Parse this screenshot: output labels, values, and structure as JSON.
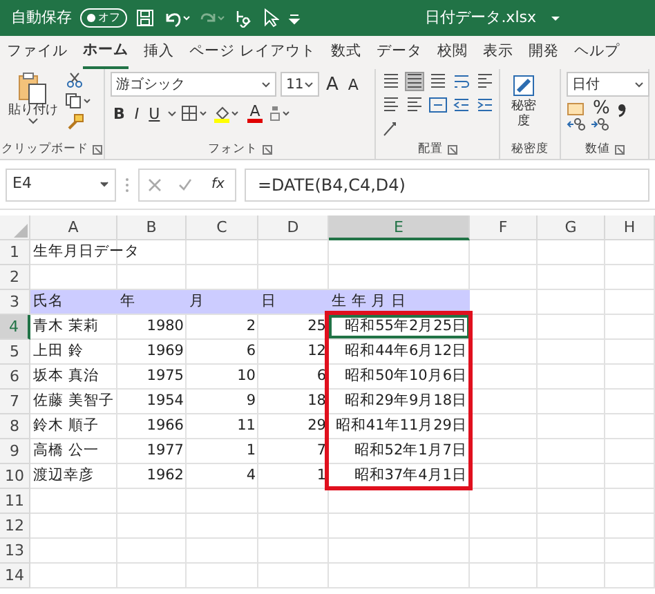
{
  "title_bar": {
    "autosave_label": "自動保存",
    "autosave_toggle": {
      "label": "オフ",
      "on": false
    },
    "file_name": "日付データ.xlsx"
  },
  "ribbon_tabs": [
    {
      "label": "ファイル",
      "selected": false
    },
    {
      "label": "ホーム",
      "selected": true
    },
    {
      "label": "挿入",
      "selected": false
    },
    {
      "label": "ページ レイアウト",
      "selected": false
    },
    {
      "label": "数式",
      "selected": false
    },
    {
      "label": "データ",
      "selected": false
    },
    {
      "label": "校閲",
      "selected": false
    },
    {
      "label": "表示",
      "selected": false
    },
    {
      "label": "開発",
      "selected": false
    },
    {
      "label": "ヘルプ",
      "selected": false
    }
  ],
  "ribbon": {
    "clipboard": {
      "paste_label": "貼り付け",
      "group_label": "クリップボード"
    },
    "font": {
      "font_name": "游ゴシック",
      "font_size": "11",
      "grow_letter": "A",
      "shrink_letter": "A",
      "bold": "B",
      "italic": "I",
      "underline": "U",
      "color_letter": "A",
      "group_label": "フォント"
    },
    "alignment": {
      "group_label": "配置"
    },
    "sensitivity": {
      "label": "秘密度",
      "group_label": "秘密度"
    },
    "number": {
      "format": "日付",
      "percent": "%",
      "group_label": "数値"
    }
  },
  "formula_bar": {
    "name_box": "E4",
    "fx_label": "fx",
    "formula": "=DATE(B4,C4,D4)"
  },
  "sheet": {
    "columns": [
      {
        "label": "A",
        "kind": "text",
        "selected": false
      },
      {
        "label": "B",
        "kind": "number",
        "selected": false
      },
      {
        "label": "C",
        "kind": "number",
        "selected": false
      },
      {
        "label": "D",
        "kind": "number",
        "selected": false
      },
      {
        "label": "E",
        "kind": "number",
        "selected": true,
        "boxed": true
      },
      {
        "label": "F",
        "kind": "number",
        "selected": false
      },
      {
        "label": "G",
        "kind": "number",
        "selected": false
      },
      {
        "label": "H",
        "kind": "number",
        "selected": false
      }
    ],
    "rows": [
      {
        "label": "1",
        "kind": "title",
        "selected": false,
        "cells": [
          "生年月日データ"
        ]
      },
      {
        "label": "2",
        "kind": "blank",
        "selected": false
      },
      {
        "label": "3",
        "kind": "header",
        "selected": false,
        "cells": [
          "氏名",
          "年",
          "月",
          "日",
          "生 年 月 日"
        ]
      },
      {
        "label": "4",
        "kind": "data",
        "selected": true,
        "cells": [
          "青木 茉莉",
          "1980",
          "2",
          "25",
          "昭和55年2月25日"
        ]
      },
      {
        "label": "5",
        "kind": "data",
        "selected": false,
        "cells": [
          "上田 鈴",
          "1969",
          "6",
          "12",
          "昭和44年6月12日"
        ]
      },
      {
        "label": "6",
        "kind": "data",
        "selected": false,
        "cells": [
          "坂本 真治",
          "1975",
          "10",
          "6",
          "昭和50年10月6日"
        ]
      },
      {
        "label": "7",
        "kind": "data",
        "selected": false,
        "cells": [
          "佐藤 美智子",
          "1954",
          "9",
          "18",
          "昭和29年9月18日"
        ]
      },
      {
        "label": "8",
        "kind": "data",
        "selected": false,
        "cells": [
          "鈴木 順子",
          "1966",
          "11",
          "29",
          "昭和41年11月29日"
        ]
      },
      {
        "label": "9",
        "kind": "data",
        "selected": false,
        "cells": [
          "高橋 公一",
          "1977",
          "1",
          "7",
          "昭和52年1月7日"
        ]
      },
      {
        "label": "10",
        "kind": "data",
        "selected": false,
        "cells": [
          "渡辺幸彦",
          "1962",
          "4",
          "1",
          "昭和37年4月1日"
        ]
      },
      {
        "label": "11",
        "kind": "blank",
        "selected": false
      },
      {
        "label": "12",
        "kind": "blank",
        "selected": false
      },
      {
        "label": "13",
        "kind": "blank",
        "selected": false
      },
      {
        "label": "14",
        "kind": "blank",
        "selected": false
      }
    ]
  }
}
